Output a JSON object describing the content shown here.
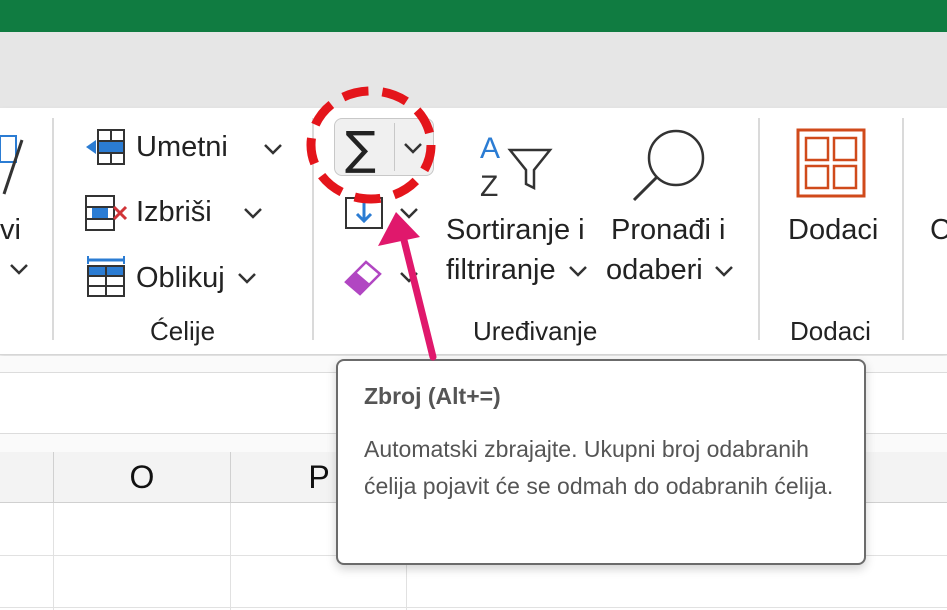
{
  "ribbon": {
    "partial_left_label_line1": "vi",
    "cells_group": {
      "label": "Ćelije",
      "insert_label": "Umetni",
      "delete_label": "Izbriši",
      "format_label": "Oblikuj"
    },
    "editing_group": {
      "label": "Uređivanje",
      "autosum_symbol": "∑",
      "sort_filter_line1": "Sortiranje i",
      "sort_filter_line2": "filtriranje",
      "find_select_line1": "Pronađi i",
      "find_select_line2": "odaberi"
    },
    "addins_group": {
      "label": "Dodaci",
      "button_label": "Dodaci"
    },
    "partial_right_label": "C"
  },
  "sheet": {
    "columns": [
      "O",
      "P"
    ]
  },
  "tooltip": {
    "title": "Zbroj (Alt+=)",
    "body": "Automatski zbrajajte. Ukupni broj odabranih ćelija pojavit će se odmah do odabranih ćelija."
  },
  "colors": {
    "title_bar": "#107c41",
    "annotation_red": "#e4151b",
    "annotation_arrow": "#e0186c",
    "icon_blue": "#2b7cd3",
    "icon_red": "#d13438",
    "eraser_purple": "#b146c2",
    "addins_orange": "#d04a1b"
  },
  "icons": [
    "insert-cells-icon",
    "delete-cells-icon",
    "format-cells-icon",
    "sigma-icon",
    "fill-down-icon",
    "eraser-icon",
    "sort-filter-icon",
    "magnifier-icon",
    "addins-grid-icon",
    "chevron-down-icon"
  ]
}
